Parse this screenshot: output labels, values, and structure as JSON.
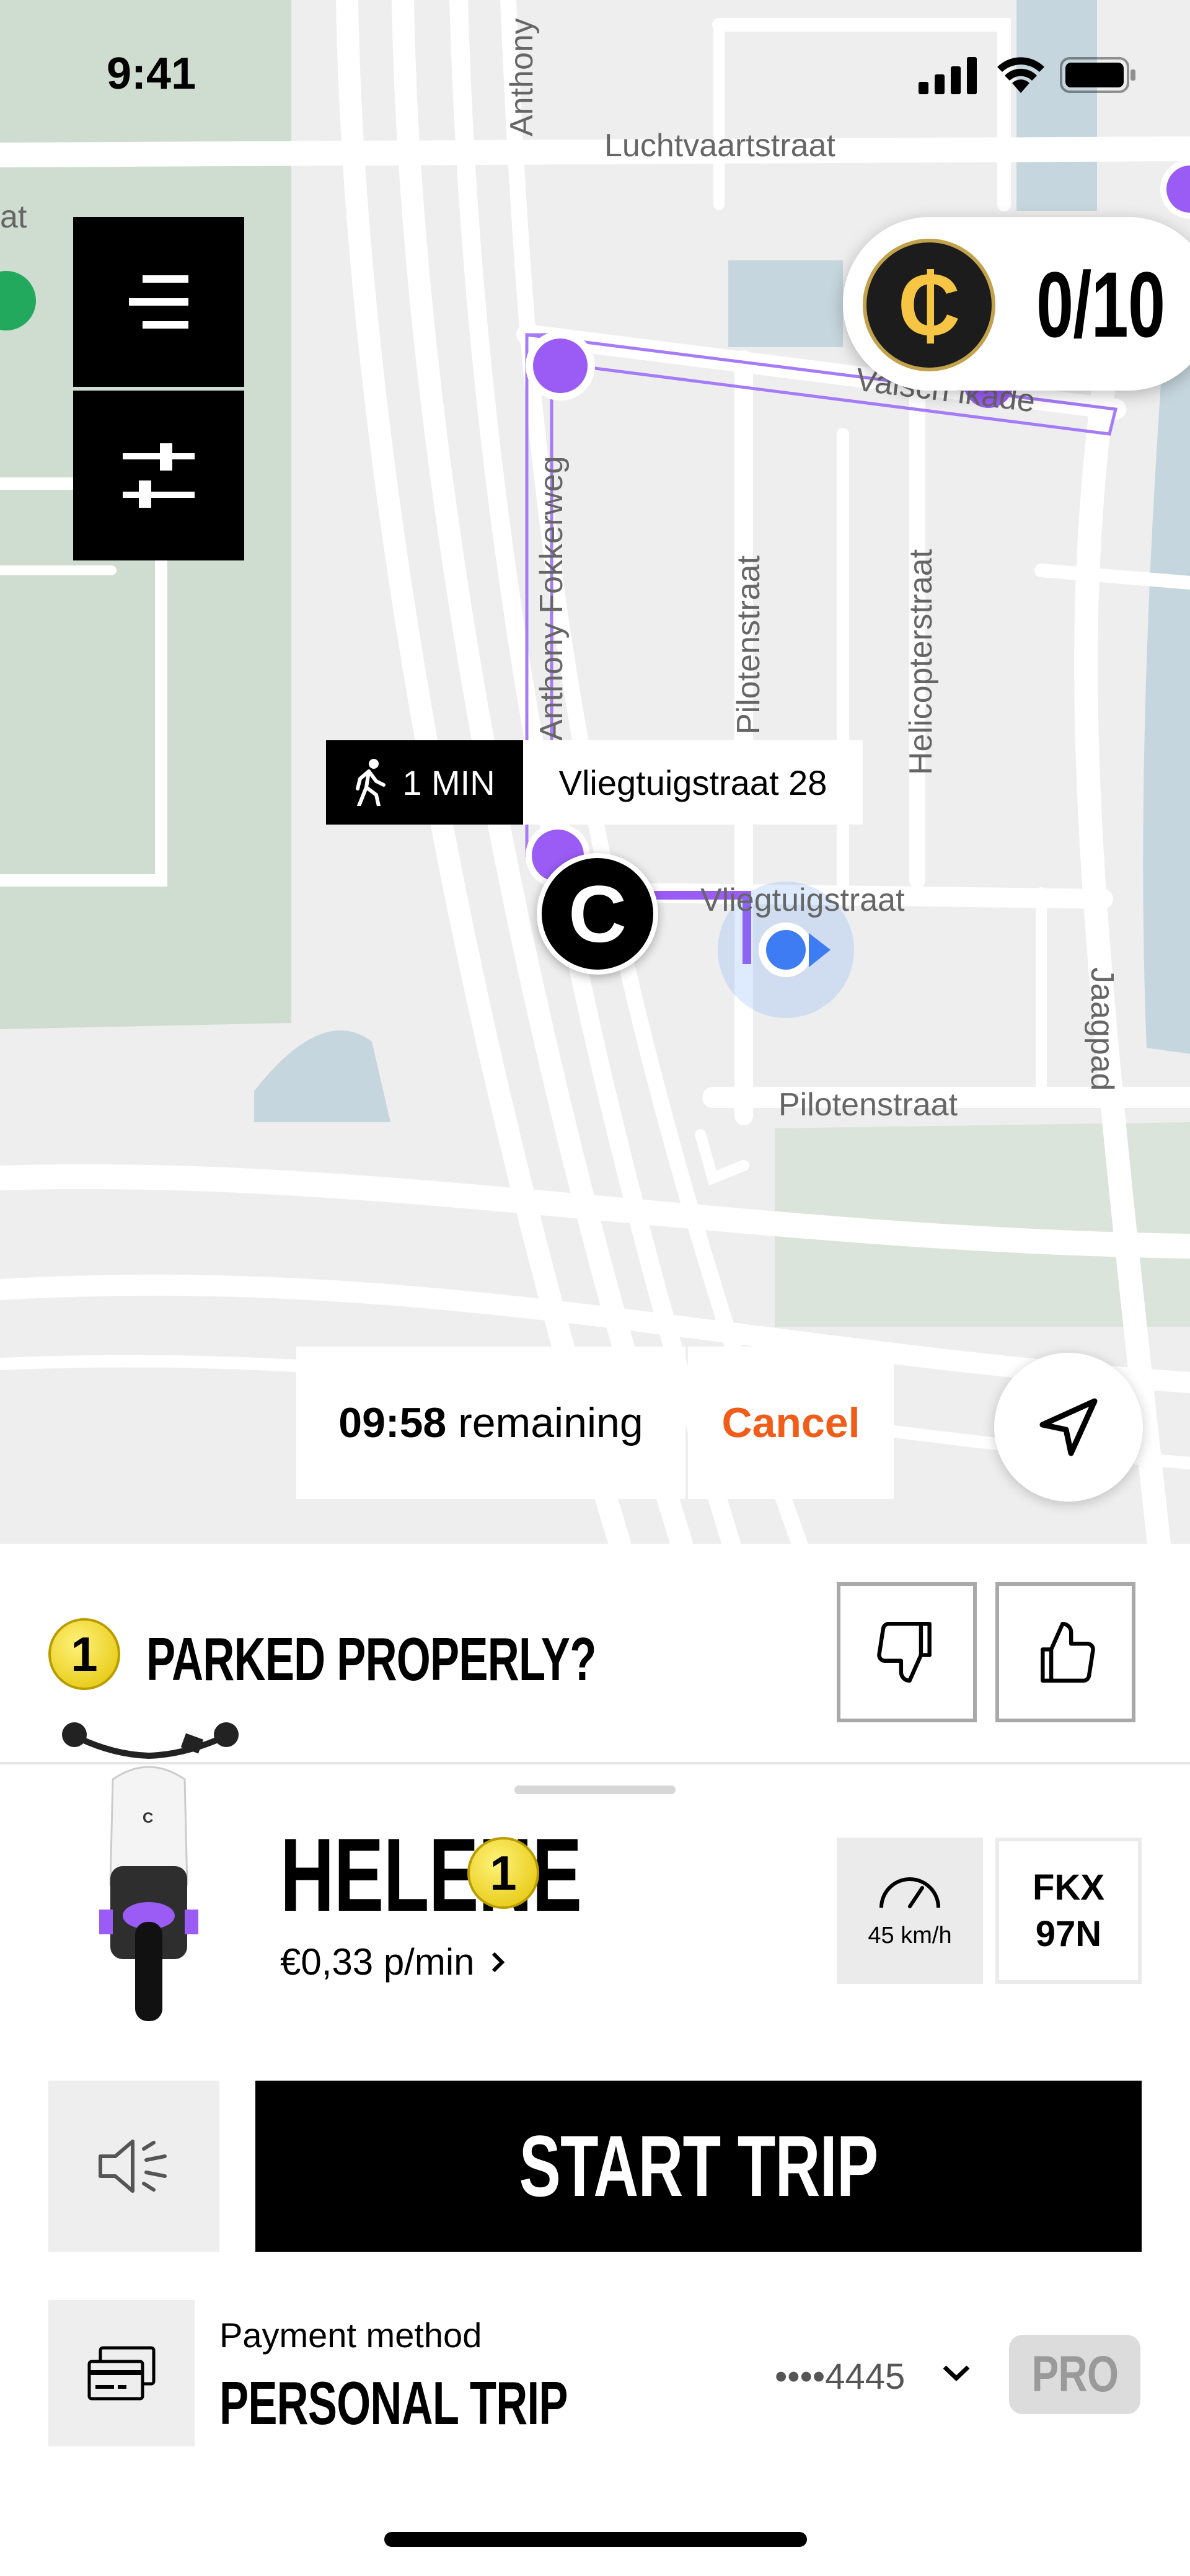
{
  "status_bar": {
    "time": "9:41"
  },
  "map": {
    "streets": {
      "anthony": "Anthony",
      "luchtvaartstraat": "Luchtvaartstraat",
      "valschkade": "Valsch  ikade",
      "anthony_fokkerweg": "Anthony Fokkerweg",
      "pilotenstraat_v": "Pilotenstraat",
      "helicopterstraat": "Helicopterstraat",
      "vliegtuigstraat": "Vliegtuigstraat",
      "pilotenstraat_h": "Pilotenstraat",
      "jaagpad": "Jaagpad",
      "edge_fragment": "at"
    },
    "coins": {
      "symbol": "₵",
      "count": "0/10"
    },
    "walk_label": {
      "time": "1 MIN",
      "address": "Vliegtuigstraat 28"
    },
    "scooter_pin_letter": "C",
    "reservation": {
      "time": "09:58",
      "suffix": " remaining",
      "cancel": "Cancel"
    }
  },
  "sheet": {
    "parked": {
      "coin": "1",
      "question": "PARKED PROPERLY?"
    },
    "vehicle": {
      "name": "HELENE",
      "coin": "1",
      "price": "€0,33 p/min",
      "speed": "45 km/h",
      "plate_line1": "FKX",
      "plate_line2": "97N"
    },
    "start_button": "START TRIP",
    "payment": {
      "label": "Payment method",
      "type": "PERSONAL TRIP",
      "card": "••••4445",
      "pro": "PRO"
    }
  },
  "colors": {
    "accent_purple": "#9b5cf5",
    "cancel_orange": "#f25c19",
    "coin_gold": "#f6c544"
  },
  "icons": [
    "signal-icon",
    "wifi-icon",
    "battery-icon",
    "menu-icon",
    "filter-icon",
    "walk-icon",
    "locate-arrow-icon",
    "thumbs-down-icon",
    "thumbs-up-icon",
    "speedometer-icon",
    "chevron-right-icon",
    "speaker-icon",
    "payment-card-icon",
    "chevron-down-icon"
  ]
}
